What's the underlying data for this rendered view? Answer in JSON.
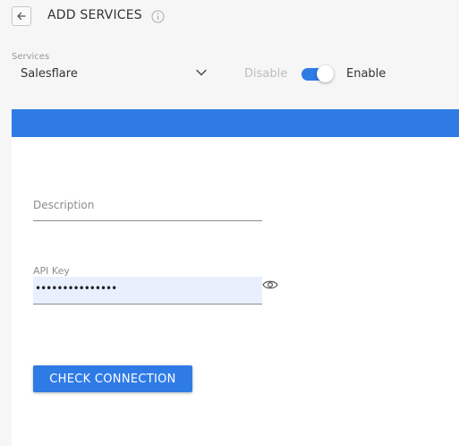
{
  "header": {
    "title": "ADD SERVICES"
  },
  "services": {
    "label": "Services",
    "selected": "Salesflare"
  },
  "toggle": {
    "disable_label": "Disable",
    "enable_label": "Enable",
    "enabled": true
  },
  "form": {
    "description_placeholder": "Description",
    "api_key_label": "API Key",
    "api_key_value": "•••••••••••••••",
    "check_button": "CHECK CONNECTION"
  },
  "colors": {
    "accent": "#2f7be6",
    "autofill_bg": "#e8f0fe"
  },
  "icons": [
    "back-arrow-icon",
    "info-icon",
    "chevron-down-icon",
    "eye-icon"
  ]
}
